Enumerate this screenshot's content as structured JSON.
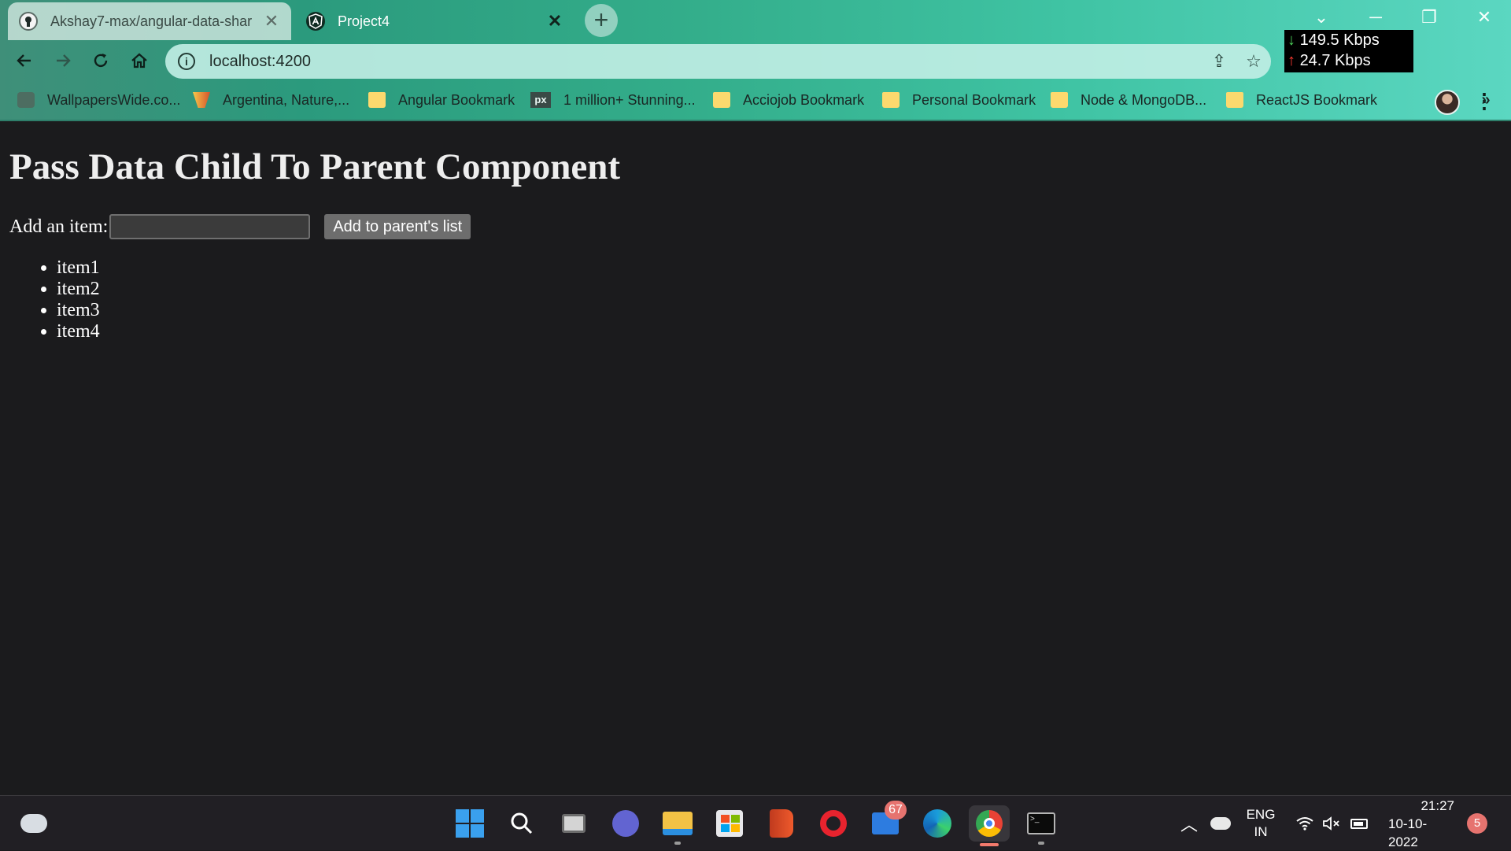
{
  "browser": {
    "tabs": [
      {
        "title": "Akshay7-max/angular-data-shar",
        "favicon": "github-icon",
        "active": false
      },
      {
        "title": "Project4",
        "favicon": "angular-icon",
        "active": true
      }
    ],
    "address": "localhost:4200",
    "net_speed": {
      "down": "149.5 Kbps",
      "up": "24.7 Kbps"
    },
    "bookmarks": [
      {
        "label": "WallpapersWide.co...",
        "icon": "wallpaperswide-icon"
      },
      {
        "label": "Argentina, Nature,...",
        "icon": "argentina-icon"
      },
      {
        "label": "Angular Bookmark",
        "icon": "folder-icon"
      },
      {
        "label": "1 million+ Stunning...",
        "icon": "pixabay-icon"
      },
      {
        "label": "Acciojob Bookmark",
        "icon": "folder-icon"
      },
      {
        "label": "Personal Bookmark",
        "icon": "folder-icon"
      },
      {
        "label": "Node & MongoDB...",
        "icon": "folder-icon"
      },
      {
        "label": "ReactJS Bookmark",
        "icon": "folder-icon"
      }
    ]
  },
  "page": {
    "heading": "Pass Data Child To Parent Component",
    "add_label": "Add an item:",
    "add_input_value": "",
    "add_button": "Add to parent's list",
    "items": [
      "item1",
      "item2",
      "item3",
      "item4"
    ]
  },
  "taskbar": {
    "mail_badge": "67",
    "lang_line1": "ENG",
    "lang_line2": "IN",
    "time": "21:27",
    "date": "10-10-2022",
    "notifications": "5"
  },
  "colors": {
    "page_background": "#1b1b1d",
    "chrome_accent": "#33ad8a"
  }
}
